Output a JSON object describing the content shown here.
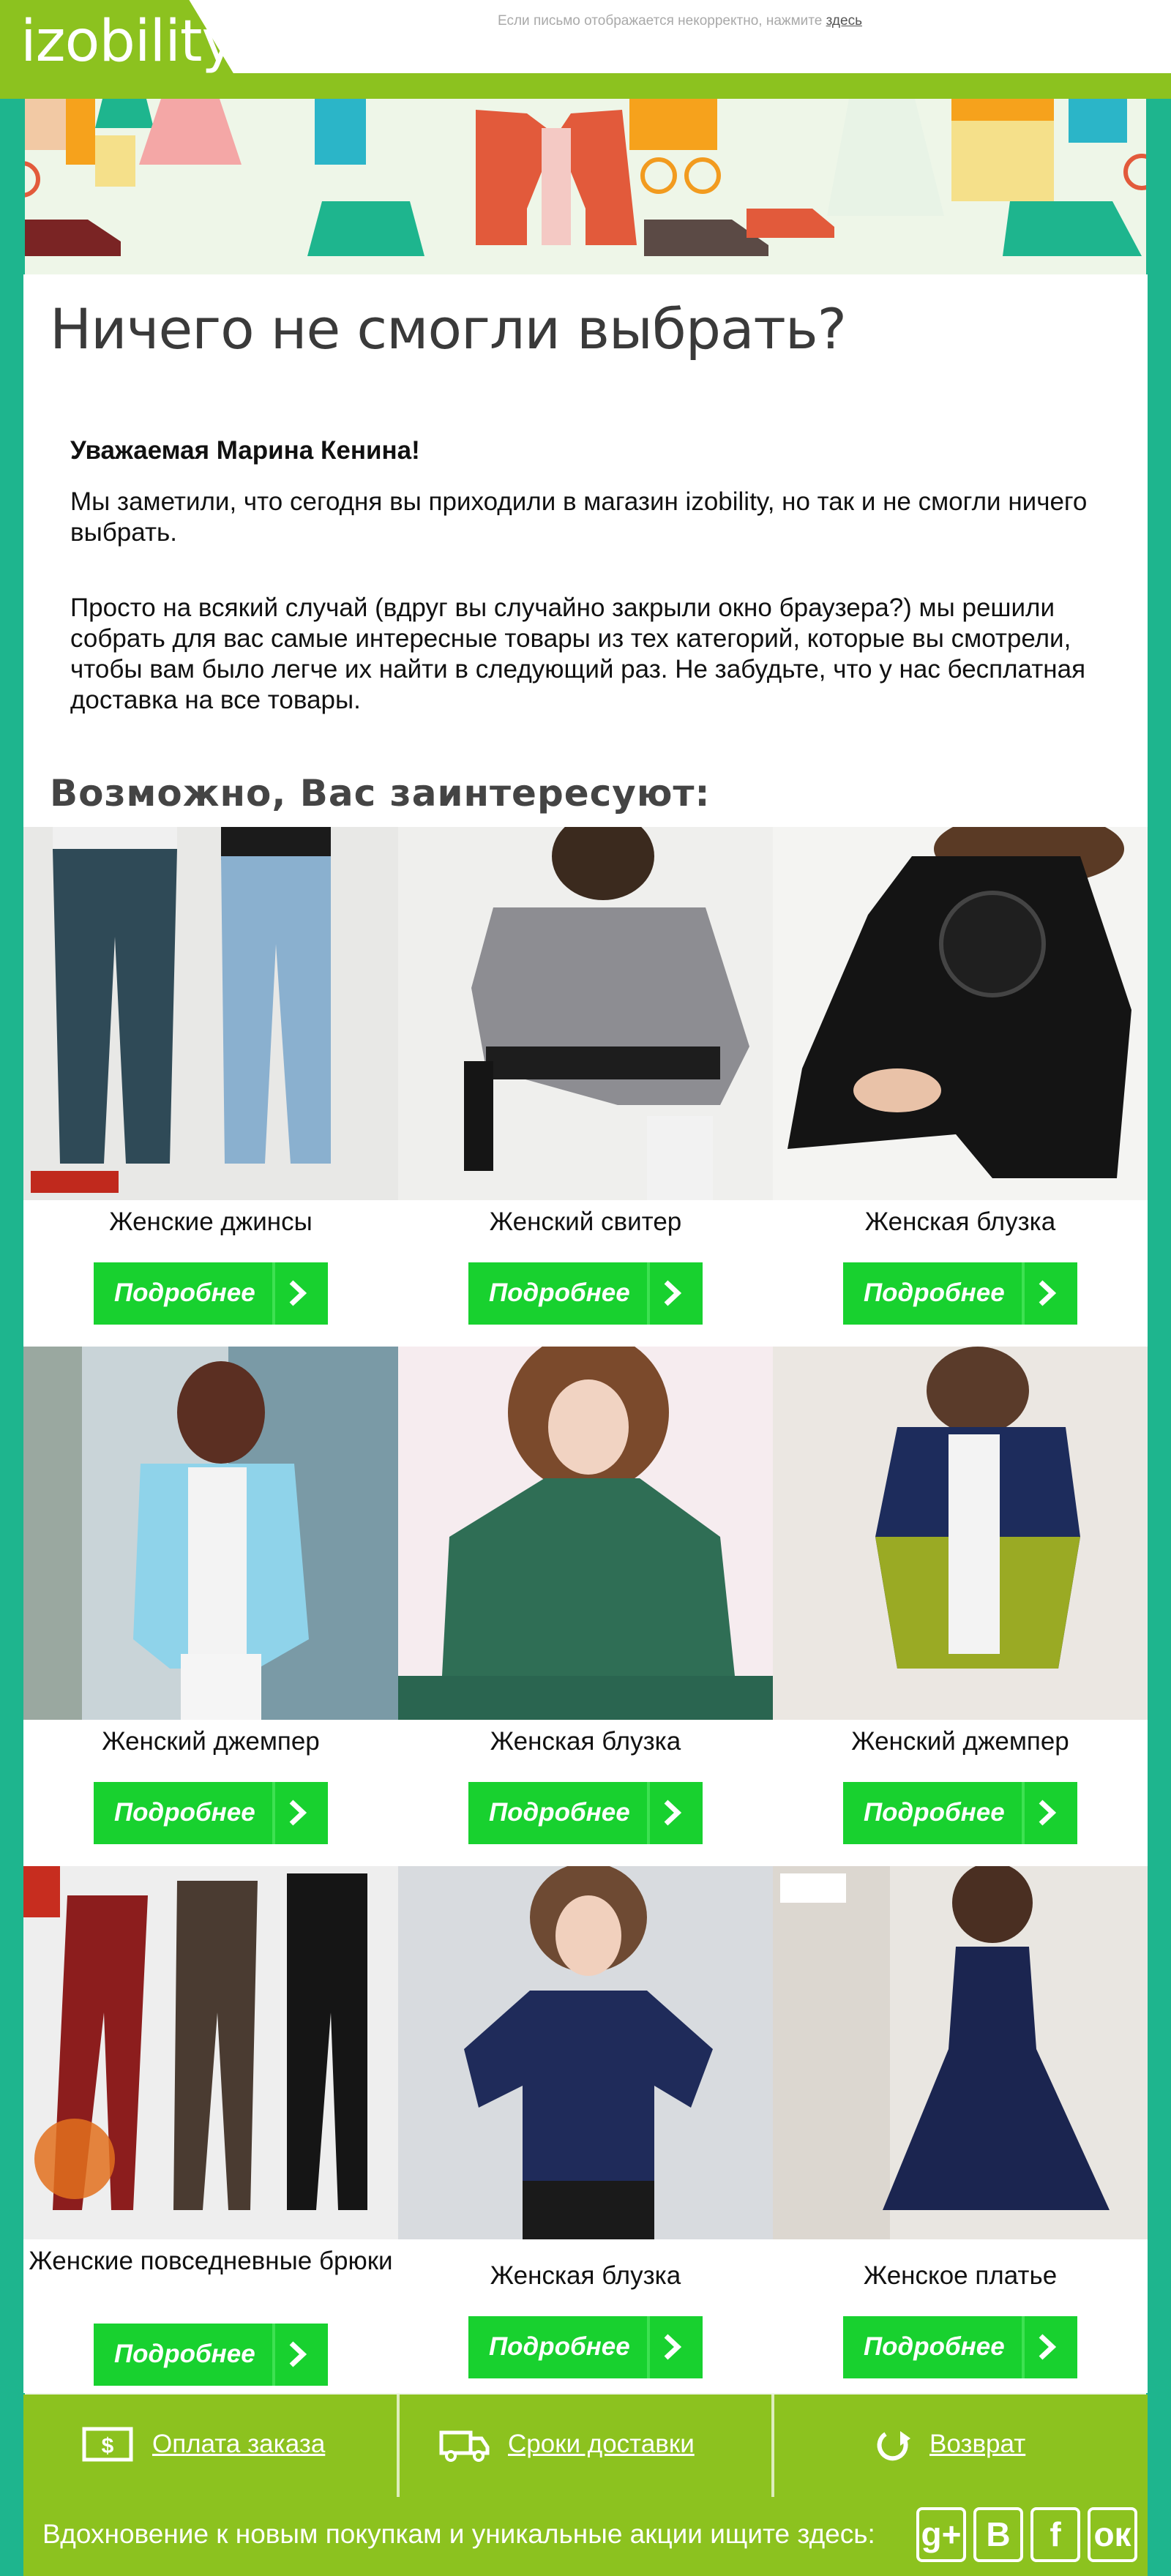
{
  "header": {
    "logo": "izobility",
    "notice_text": "Если письмо отображается некорректно, нажмите",
    "notice_link": "здесь",
    "brand_color": "#8cc21f"
  },
  "intro": {
    "title": "Ничего не смогли выбрать?",
    "greeting": "Уважаемая Марина Кенина!",
    "paragraph1": "Мы заметили, что сегодня вы приходили в магазин izobility, но так и не смогли ничего выбрать.",
    "paragraph2": "Просто на всякий случай (вдруг вы случайно закрыли окно браузера?) мы решили собрать для вас самые интересные товары из тех категорий, которые вы смотрели, чтобы вам было легче их найти в следующий раз. Не забудьте, что у нас бесплатная доставка на все товары.",
    "subtitle": "Возможно, Вас заинтересуют:"
  },
  "products": [
    {
      "name": "Женские джинсы",
      "button": "Подробнее",
      "image": "jeans-photo"
    },
    {
      "name": "Женский свитер",
      "button": "Подробнее",
      "image": "sweater-photo"
    },
    {
      "name": "Женская блузка",
      "button": "Подробнее",
      "image": "black-lace-blouse-photo"
    },
    {
      "name": "Женский джемпер",
      "button": "Подробнее",
      "image": "light-blue-cardigan-photo"
    },
    {
      "name": "Женская блузка",
      "button": "Подробнее",
      "image": "green-lace-blouse-photo"
    },
    {
      "name": "Женский джемпер",
      "button": "Подробнее",
      "image": "navy-olive-cardigan-photo"
    },
    {
      "name": "Женские повседневные брюки",
      "button": "Подробнее",
      "image": "trousers-photo"
    },
    {
      "name": "Женская блузка",
      "button": "Подробнее",
      "image": "navy-blouse-photo"
    },
    {
      "name": "Женское платье",
      "button": "Подробнее",
      "image": "navy-dress-photo"
    }
  ],
  "button_color": "#18d12f",
  "footer": {
    "links": [
      {
        "label": "Оплата заказа",
        "icon": "payment-icon"
      },
      {
        "label": "Сроки доставки",
        "icon": "truck-icon"
      },
      {
        "label": "Возврат",
        "icon": "return-icon"
      }
    ],
    "social_text": "Вдохновение к новым покупкам и уникальные акции ищите здесь:",
    "social": [
      {
        "label": "g+",
        "icon": "google-plus-icon"
      },
      {
        "label": "В",
        "icon": "vk-icon"
      },
      {
        "label": "f",
        "icon": "facebook-icon"
      },
      {
        "label": "ок",
        "icon": "odnoklassniki-icon"
      }
    ]
  }
}
